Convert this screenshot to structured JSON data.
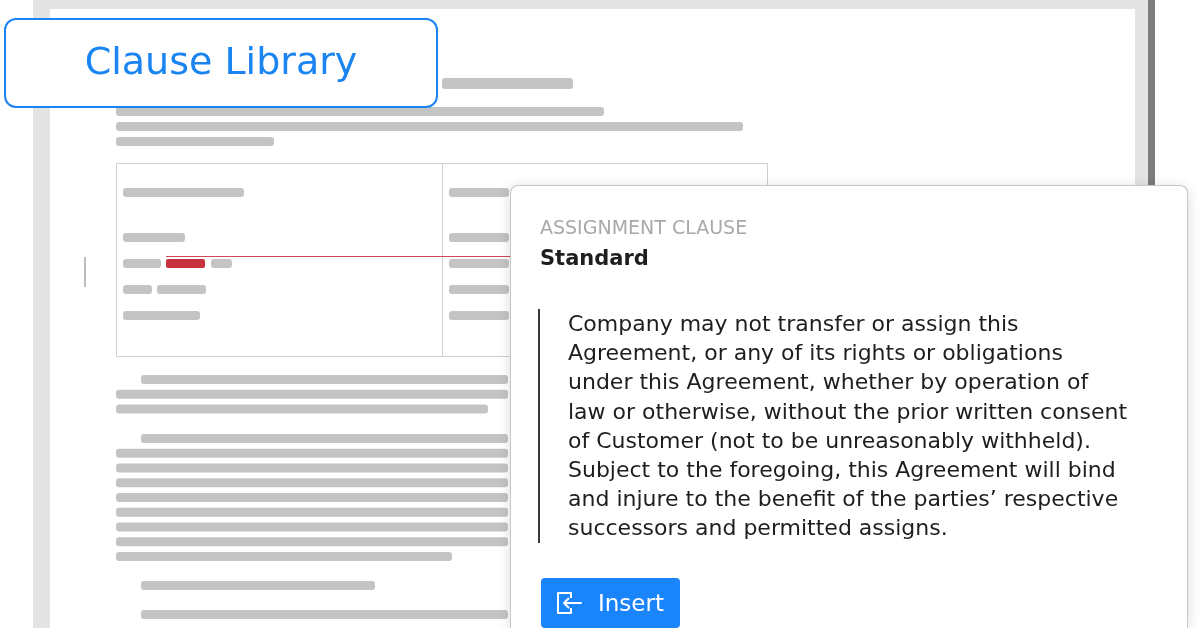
{
  "callout": {
    "title": "Clause Library"
  },
  "clause_card": {
    "category": "ASSIGNMENT CLAUSE",
    "variant": "Standard",
    "text": "Company may not transfer or assign this Agreement, or any of its rights or obligations under this Agreement, whether by operation of law or otherwise, without the prior written consent of Customer (not to be unreasonably withheld). Subject to the foregoing, this Agreement will bind and injure to the benefit of the parties’ respective successors and permitted assigns.",
    "button": {
      "label": "Insert"
    }
  }
}
